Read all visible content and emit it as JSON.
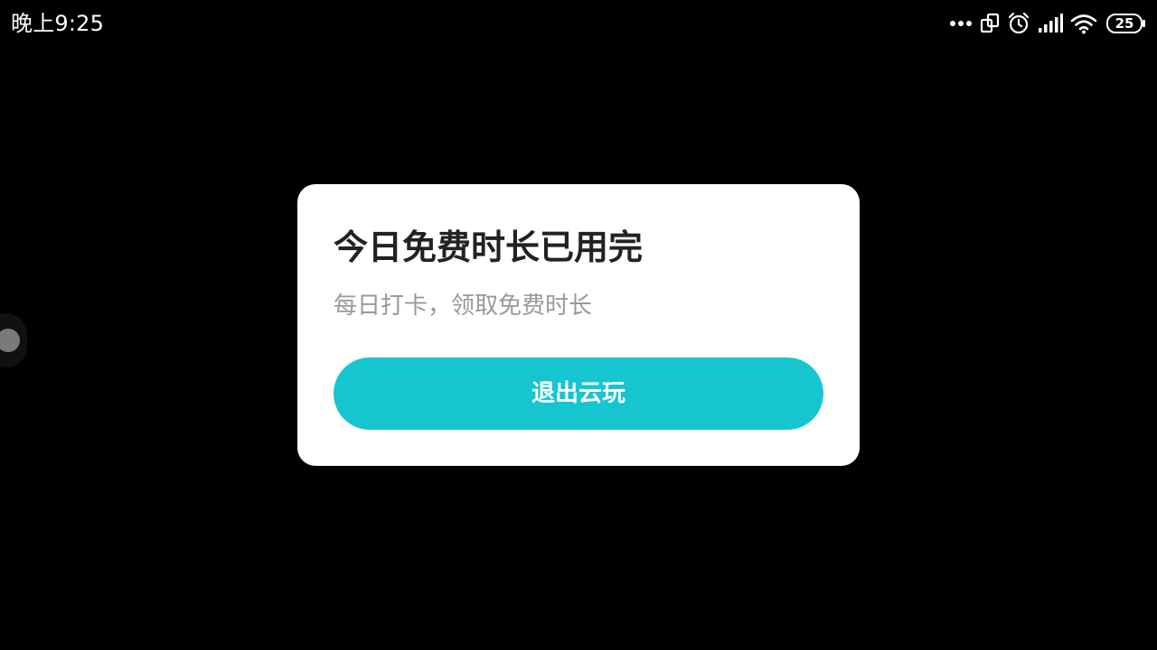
{
  "status_bar": {
    "time": "晚上9:25",
    "battery_level": "25",
    "icons": [
      "more-dots-icon",
      "screen-rotate-icon",
      "alarm-icon",
      "signal-icon",
      "wifi-icon",
      "battery-icon"
    ]
  },
  "dialog": {
    "title": "今日免费时长已用完",
    "subtitle": "每日打卡，领取免费时长",
    "exit_button_label": "退出云玩"
  },
  "colors": {
    "background": "#000000",
    "dialog_bg": "#ffffff",
    "accent": "#16c5cf",
    "title": "#222222",
    "subtitle": "#999999"
  }
}
